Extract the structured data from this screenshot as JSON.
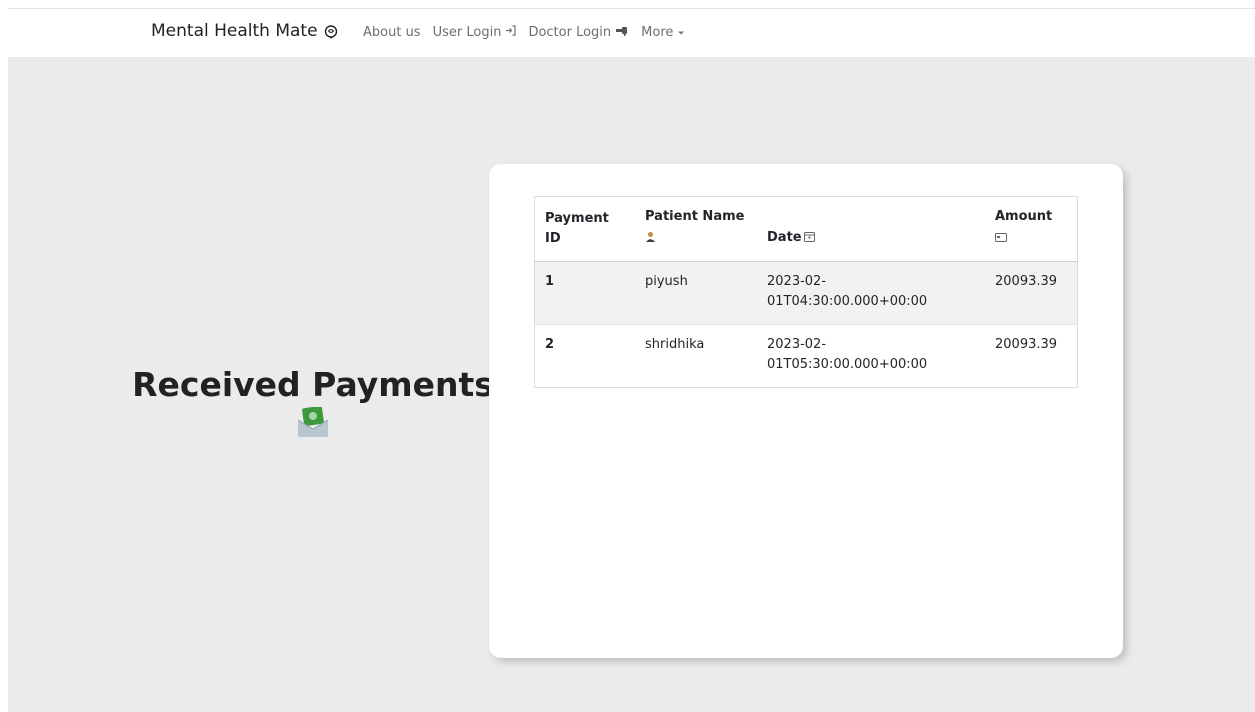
{
  "navbar": {
    "brand": "Mental Health Mate",
    "brand_icon": "brain-icon",
    "links": [
      {
        "label": "About us",
        "icon": ""
      },
      {
        "label": "User Login",
        "icon": "login-arrow-icon"
      },
      {
        "label": "Doctor Login",
        "icon": "doctor-icon"
      },
      {
        "label": "More",
        "icon": "caret-down-icon"
      }
    ]
  },
  "main": {
    "title": "Received Payments",
    "title_icon": "money-envelope-icon"
  },
  "table": {
    "headers": [
      {
        "label": "Payment ID",
        "icon": ""
      },
      {
        "label": "Patient Name",
        "icon": "person-icon"
      },
      {
        "label": "Date",
        "icon": "calendar-icon"
      },
      {
        "label": "Amount",
        "icon": "card-icon"
      }
    ],
    "rows": [
      {
        "id": "1",
        "patient": "piyush",
        "date_line1": "2023-02-",
        "date_line2": "01T04:30:00.000+00:00",
        "amount": "20093.39"
      },
      {
        "id": "2",
        "patient": "shridhika",
        "date_line1": "2023-02-",
        "date_line2": "01T05:30:00.000+00:00",
        "amount": "20093.39"
      }
    ]
  },
  "colors": {
    "background": "#ebebeb",
    "card": "#ffffff",
    "accent_green": "#3c9a3c"
  }
}
